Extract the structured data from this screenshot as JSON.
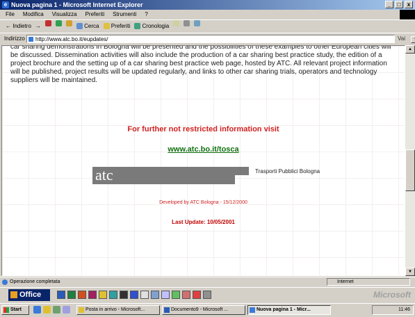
{
  "window": {
    "title": "Nuova pagina 1 - Microsoft Internet Explorer",
    "buttons": [
      "_",
      "□",
      "x"
    ]
  },
  "menubar": {
    "items": [
      "File",
      "Modifica",
      "Visualizza",
      "Preferiti",
      "Strumenti",
      "?"
    ]
  },
  "toolbar": {
    "back_label": "Indietro",
    "forward_label": "→",
    "search_label": "Cerca",
    "favorites_label": "Preferiti",
    "history_label": "Cronologia"
  },
  "address": {
    "label": "Indirizzo",
    "value": "http://www.atc.bo.it/eupdates/",
    "go_label": "Vai"
  },
  "page": {
    "paragraph": "car sharing demonstrations in Bologna will be presented and the possibilities of these examples to other European cities will be discussed. Dissemination activities will also include the production of a car sharing best practice study, the edition of a project brochure and the setting up of a car sharing best practice web page, hosted by ATC. All relevant project information will be published, project results will be updated regularly, and links to other car sharing trials, operators and technology suppliers will be maintained.",
    "info_heading": "For further not restricted information visit",
    "info_link": "www.atc.bo.it/tosca",
    "logo_text": "atc",
    "logo_caption": "Trasporti Pubblici Bologna",
    "developed_by": "Developed by ATC Bologna  -  15/12/2000",
    "last_update": "Last Update: 10/05/2001"
  },
  "statusbar": {
    "status": "Operazione completata",
    "zone": "Internet"
  },
  "officebar": {
    "label": "Office",
    "brand": "Microsoft"
  },
  "taskbar": {
    "start_label": "Start",
    "tasks": [
      {
        "label": "Posta in arrivo - Microsoft...",
        "active": false
      },
      {
        "label": "Documento9 - Microsoft ...",
        "active": false
      },
      {
        "label": "Nuova pagina 1 - Micr...",
        "active": true
      }
    ],
    "clock": "11:46"
  },
  "colors": {
    "heading_red": "#d02020",
    "link_green": "#107010",
    "title_blue": "#0a246a"
  }
}
